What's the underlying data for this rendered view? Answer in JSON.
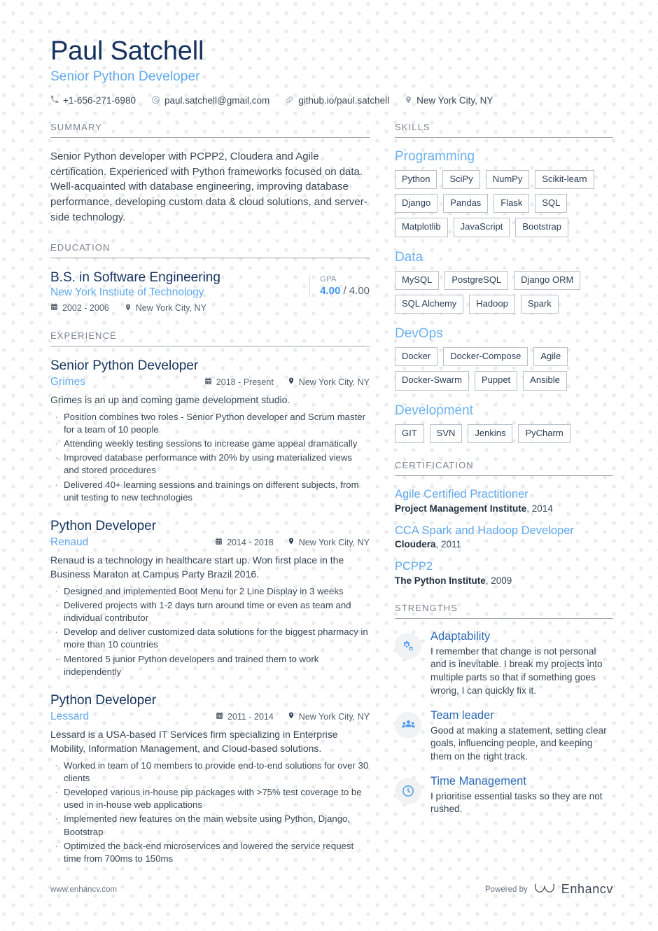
{
  "header": {
    "name": "Paul Satchell",
    "role": "Senior Python Developer",
    "contacts": [
      {
        "icon": "phone-icon",
        "text": "+1-656-271-6980"
      },
      {
        "icon": "email-icon",
        "text": "paul.satchell@gmail.com"
      },
      {
        "icon": "link-icon",
        "text": "github.io/paul.satchell"
      },
      {
        "icon": "location-pin-icon",
        "text": "New York City, NY"
      }
    ]
  },
  "summary": {
    "title": "SUMMARY",
    "text": "Senior Python developer with PCPP2, Cloudera and Agile certification. Experienced with Python frameworks focused on data. Well-acquainted with database engineering, improving database performance, developing custom data & cloud solutions, and server-side technology."
  },
  "education": {
    "title": "EDUCATION",
    "entries": [
      {
        "degree": "B.S. in Software Engineering",
        "school": "New York Instiute of Technology",
        "dates": "2002 - 2006",
        "location": "New York City, NY",
        "gpa_label": "GPA",
        "gpa_value": "4.00",
        "gpa_max": "/ 4.00"
      }
    ]
  },
  "experience": {
    "title": "EXPERIENCE",
    "entries": [
      {
        "role": "Senior Python Developer",
        "company": "Grimes",
        "dates": "2018 - Present",
        "location": "New York City, NY",
        "description": "Grimes is an up and coming game development studio.",
        "bullets": [
          "Position combines two roles - Senior Python developer and Scrum master for a team of 10 people",
          "Attending weekly testing sessions to increase game appeal dramatically",
          "Improved database performance with 20% by using materialized views and stored procedures",
          "Delivered 40+ learning sessions and trainings on different subjects, from unit testing to new technologies"
        ]
      },
      {
        "role": "Python Developer",
        "company": "Renaud",
        "dates": "2014 - 2018",
        "location": "New York City, NY",
        "description": "Renaud is a technology in healthcare start up. Won first place in the Business Maraton at Campus Party Brazil 2016.",
        "bullets": [
          "Designed and implemented Boot Menu for 2 Line Display in 3 weeks",
          "Delivered projects with 1-2 days turn around time or even as team and individual contributor",
          "Develop and deliver customized data solutions for the biggest pharmacy in more than 10 countries",
          "Mentored 5 junior Python developers and trained them to work independently"
        ]
      },
      {
        "role": "Python Developer",
        "company": "Lessard",
        "dates": "2011 - 2014",
        "location": "New York City, NY",
        "description": "Lessard is a USA-based IT Services firm specializing in Enterprise Mobility, Information Management, and Cloud-based solutions.",
        "bullets": [
          "Worked in team of 10 members to provide end-to-end solutions for over 30 clients",
          "Developed various in-house pip packages with >75% test coverage to be used in in-house web applications",
          "Implemented new features on the main website using Python, Django, Bootstrap",
          "Optimized the back-end microservices and lowered the service request time from 700ms to 150ms"
        ]
      }
    ]
  },
  "skills": {
    "title": "SKILLS",
    "groups": [
      {
        "name": "Programming",
        "items": [
          "Python",
          "SciPy",
          "NumPy",
          "Scikit-learn",
          "Django",
          "Pandas",
          "Flask",
          "SQL",
          "Matplotlib",
          "JavaScript",
          "Bootstrap"
        ]
      },
      {
        "name": "Data",
        "items": [
          "MySQL",
          "PostgreSQL",
          "Django ORM",
          "SQL Alchemy",
          "Hadoop",
          "Spark"
        ]
      },
      {
        "name": "DevOps",
        "items": [
          "Docker",
          "Docker-Compose",
          "Agile",
          "Docker-Swarm",
          "Puppet",
          "Ansible"
        ]
      },
      {
        "name": "Development",
        "items": [
          "GIT",
          "SVN",
          "Jenkins",
          "PyCharm"
        ]
      }
    ]
  },
  "certification": {
    "title": "CERTIFICATION",
    "entries": [
      {
        "name": "Agile Certified Practitioner",
        "issuer": "Project Management Institute",
        "year": ", 2014"
      },
      {
        "name": "CCA Spark and Hadoop Developer",
        "issuer": "Cloudera",
        "year": ", 2011"
      },
      {
        "name": "PCPP2",
        "issuer": "The Python Institute",
        "year": ", 2009"
      }
    ]
  },
  "strengths": {
    "title": "STRENGTHS",
    "entries": [
      {
        "icon": "gears-icon",
        "title": "Adaptability",
        "description": "I remember that change is not personal and is inevitable. I break my projects into multiple parts so that if something goes wrong, I can quickly fix it."
      },
      {
        "icon": "people-group-icon",
        "title": "Team leader",
        "description": "Good at making a statement, setting clear goals, influencing people, and keeping them on the right track."
      },
      {
        "icon": "clock-icon",
        "title": "Time Management",
        "description": "I prioritise essential tasks so they are not rushed."
      }
    ]
  },
  "footer": {
    "website": "www.enhancv.com",
    "powered_by": "Powered by",
    "brand": "Enhancv"
  },
  "colors": {
    "name_navy": "#14325c",
    "accent_blue": "#5fa8ec",
    "link_blue": "#3d94e8",
    "body_text": "#3a4754",
    "muted": "#7a8492"
  }
}
